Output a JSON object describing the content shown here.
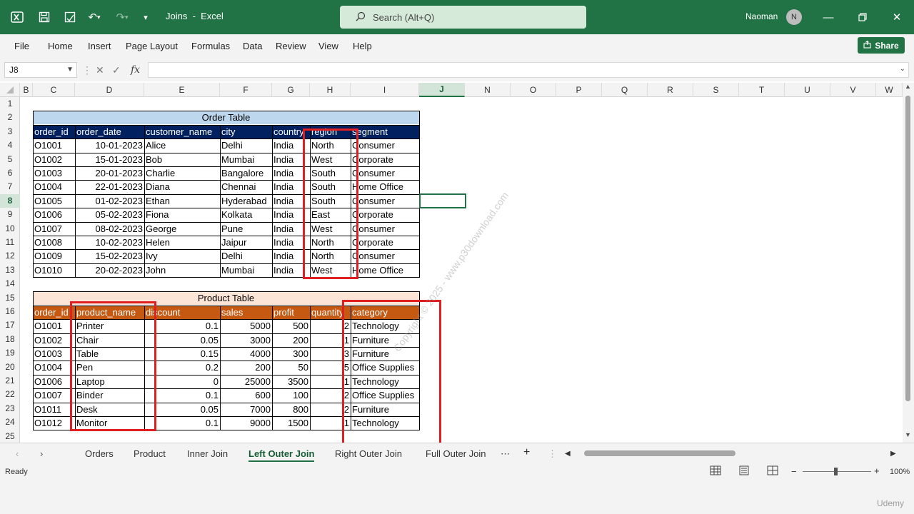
{
  "app": {
    "doc_title": "Joins  -  Excel",
    "search_placeholder": "Search (Alt+Q)",
    "user_name": "Naoman",
    "user_initial": "N",
    "accent": "#217346"
  },
  "menu": {
    "items": [
      "File",
      "Home",
      "Insert",
      "Page Layout",
      "Formulas",
      "Data",
      "Review",
      "View",
      "Help"
    ],
    "share_label": "Share"
  },
  "formula_bar": {
    "name_box": "J8",
    "fx": "fx",
    "content": ""
  },
  "columns": [
    "B",
    "C",
    "D",
    "E",
    "F",
    "G",
    "H",
    "I",
    "J",
    "N",
    "O",
    "P",
    "Q",
    "R",
    "S",
    "T",
    "U",
    "V",
    "W"
  ],
  "active_cell": {
    "column": "J",
    "row": "8"
  },
  "rows": [
    "1",
    "2",
    "3",
    "4",
    "5",
    "6",
    "7",
    "8",
    "9",
    "10",
    "11",
    "12",
    "13",
    "14",
    "15",
    "16",
    "17",
    "18",
    "19",
    "20",
    "21",
    "22",
    "23",
    "24",
    "25"
  ],
  "order_table": {
    "title": "Order Table",
    "headers": [
      "order_id",
      "order_date",
      "customer_name",
      "city",
      "country",
      "region",
      "segment"
    ],
    "rows": [
      [
        "O1001",
        "10-01-2023",
        "Alice",
        "Delhi",
        "India",
        "North",
        "Consumer"
      ],
      [
        "O1002",
        "15-01-2023",
        "Bob",
        "Mumbai",
        "India",
        "West",
        "Corporate"
      ],
      [
        "O1003",
        "20-01-2023",
        "Charlie",
        "Bangalore",
        "India",
        "South",
        "Consumer"
      ],
      [
        "O1004",
        "22-01-2023",
        "Diana",
        "Chennai",
        "India",
        "South",
        "Home Office"
      ],
      [
        "O1005",
        "01-02-2023",
        "Ethan",
        "Hyderabad",
        "India",
        "South",
        "Consumer"
      ],
      [
        "O1006",
        "05-02-2023",
        "Fiona",
        "Kolkata",
        "India",
        "East",
        "Corporate"
      ],
      [
        "O1007",
        "08-02-2023",
        "George",
        "Pune",
        "India",
        "West",
        "Consumer"
      ],
      [
        "O1008",
        "10-02-2023",
        "Helen",
        "Jaipur",
        "India",
        "North",
        "Corporate"
      ],
      [
        "O1009",
        "15-02-2023",
        "Ivy",
        "Delhi",
        "India",
        "North",
        "Consumer"
      ],
      [
        "O1010",
        "20-02-2023",
        "John",
        "Mumbai",
        "India",
        "West",
        "Home Office"
      ]
    ]
  },
  "product_table": {
    "title": "Product Table",
    "headers": [
      "order_id",
      "product_name",
      "discount",
      "sales",
      "profit",
      "quantity",
      "category"
    ],
    "rows": [
      [
        "O1001",
        "Printer",
        "0.1",
        "5000",
        "500",
        "2",
        "Technology"
      ],
      [
        "O1002",
        "Chair",
        "0.05",
        "3000",
        "200",
        "1",
        "Furniture"
      ],
      [
        "O1003",
        "Table",
        "0.15",
        "4000",
        "300",
        "3",
        "Furniture"
      ],
      [
        "O1004",
        "Pen",
        "0.2",
        "200",
        "50",
        "5",
        "Office Supplies"
      ],
      [
        "O1006",
        "Laptop",
        "0",
        "25000",
        "3500",
        "1",
        "Technology"
      ],
      [
        "O1007",
        "Binder",
        "0.1",
        "600",
        "100",
        "2",
        "Office Supplies"
      ],
      [
        "O1011",
        "Desk",
        "0.05",
        "7000",
        "800",
        "2",
        "Furniture"
      ],
      [
        "O1012",
        "Monitor",
        "0.1",
        "9000",
        "1500",
        "1",
        "Technology"
      ]
    ]
  },
  "watermark": "Copyright © 2025 - www.p30download.com",
  "sheet_tabs": [
    "Orders",
    "Product",
    "Inner Join",
    "Left Outer Join",
    "Right Outer Join",
    "Full Outer Join"
  ],
  "active_tab": "Left Outer Join",
  "status": {
    "ready": "Ready",
    "zoom": "100%"
  },
  "udemy": "Udemy",
  "colors": {
    "order_title_bg": "#bdd7ee",
    "order_header_bg": "#002060",
    "product_title_bg": "#fce4d6",
    "product_header_bg": "#c65911",
    "highlight_box": "#e02020"
  }
}
